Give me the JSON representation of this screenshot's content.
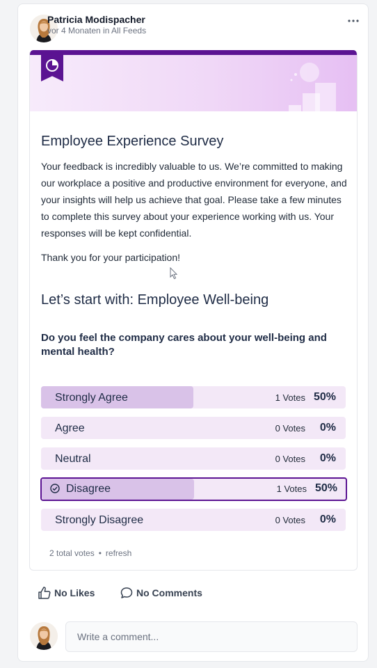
{
  "post": {
    "author": "Patricia Modispacher",
    "meta": "vor 4 Monaten in All Feeds"
  },
  "survey": {
    "title": "Employee Experience Survey",
    "description": "Your feedback is incredibly valuable to us. We’re committed to making our workplace a positive and productive environment for everyone, and your insights will help us achieve that goal. Please take a few minutes to complete this survey about your experience working with us. Your responses will be kept confidential.",
    "thanks": "Thank you for your participation!",
    "section": "Let’s start with: Employee Well-being",
    "question": "Do you feel the company cares about your well-being and mental health?",
    "options": [
      {
        "label": "Strongly Agree",
        "votes": "1 Votes",
        "percent": "50%",
        "share": 0.5,
        "selected": false
      },
      {
        "label": "Agree",
        "votes": "0 Votes",
        "percent": "0%",
        "share": 0,
        "selected": false
      },
      {
        "label": "Neutral",
        "votes": "0 Votes",
        "percent": "0%",
        "share": 0,
        "selected": false
      },
      {
        "label": "Disagree",
        "votes": "1 Votes",
        "percent": "50%",
        "share": 0.5,
        "selected": true
      },
      {
        "label": "Strongly Disagree",
        "votes": "0 Votes",
        "percent": "0%",
        "share": 0,
        "selected": false
      }
    ],
    "total_votes": "2 total votes",
    "refresh": "refresh"
  },
  "actions": {
    "likes": "No Likes",
    "comments": "No Comments"
  },
  "comment": {
    "placeholder": "Write a comment..."
  },
  "colors": {
    "accent": "#5b1392",
    "option_bg": "#f3e8f7",
    "option_fill": "#d9c2e8"
  }
}
